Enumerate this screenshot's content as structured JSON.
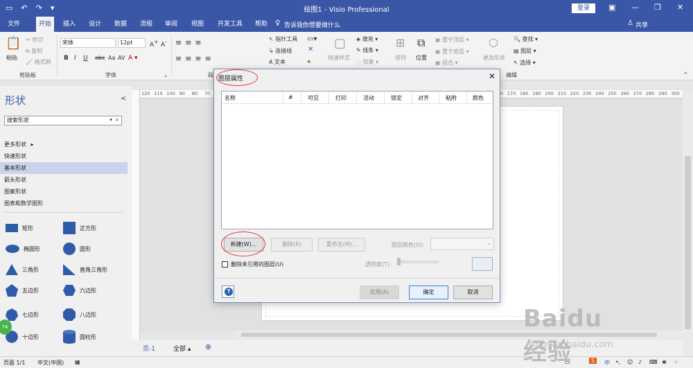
{
  "app": {
    "doc_title": "绘图1 - Visio Professional",
    "login_label": "登录",
    "accent": "#3a57a7"
  },
  "menu": {
    "tabs": [
      "文件",
      "开始",
      "插入",
      "设计",
      "数据",
      "流程",
      "审阅",
      "视图",
      "开发工具",
      "帮助"
    ],
    "active_tab": "开始",
    "tellme": "告诉我你想要做什么",
    "share": "共享"
  },
  "ribbon": {
    "paste": "粘贴",
    "cut": "剪切",
    "copy": "复制",
    "format_painter": "格式刷",
    "clipboard_group": "剪贴板",
    "font_name": "宋体",
    "font_size": "12pt",
    "font_group": "字体",
    "paragraph_group": "段",
    "pointer_tool": "指针工具",
    "connector": "连接线",
    "text": "文本",
    "quick_styles": "快速样式",
    "fill": "填充",
    "line": "线条",
    "effects": "效果",
    "arrange": "排列",
    "position": "位置",
    "bring_front": "置于顶层",
    "send_back": "置于底层",
    "group": "组合",
    "change_shape": "更改形状",
    "find": "查找",
    "layers": "图层",
    "select": "选择",
    "editing_group": "编辑"
  },
  "shapes_pane": {
    "title": "形状",
    "search_placeholder": "搜索形状",
    "stencils": [
      "更多形状",
      "快速形状",
      "基本形状",
      "箭头形状",
      "图案形状",
      "图表和数学图形"
    ],
    "active_stencil": "基本形状",
    "items": [
      {
        "label": "矩形",
        "icon": "rectangle-icon"
      },
      {
        "label": "正方形",
        "icon": "square-icon"
      },
      {
        "label": "椭圆形",
        "icon": "ellipse-icon"
      },
      {
        "label": "圆形",
        "icon": "circle-icon"
      },
      {
        "label": "三角形",
        "icon": "triangle-icon"
      },
      {
        "label": "直角三角形",
        "icon": "right-triangle-icon"
      },
      {
        "label": "五边形",
        "icon": "pentagon-icon"
      },
      {
        "label": "六边形",
        "icon": "hexagon-icon"
      },
      {
        "label": "七边形",
        "icon": "heptagon-icon"
      },
      {
        "label": "八边形",
        "icon": "octagon-icon"
      },
      {
        "label": "十边形",
        "icon": "decagon-icon"
      },
      {
        "label": "圆柱形",
        "icon": "cylinder-icon"
      }
    ],
    "badge": "74"
  },
  "ruler": {
    "labels": [
      "120",
      "110",
      "100",
      "90",
      "80",
      "70",
      "60",
      "50",
      "40",
      "30",
      "20",
      "10",
      "0",
      "10",
      "20",
      "30",
      "40",
      "50",
      "60",
      "70",
      "80",
      "90",
      "100",
      "110",
      "120",
      "130",
      "140",
      "150",
      "160",
      "170",
      "180",
      "190",
      "200",
      "210",
      "220",
      "230",
      "240",
      "250",
      "260",
      "270",
      "280",
      "290",
      "300",
      "310",
      "320",
      "330",
      "340",
      "350",
      "360",
      "370",
      "380"
    ]
  },
  "page_tabs": {
    "page1": "页-1",
    "all": "全部"
  },
  "status": {
    "page": "页面 1/1",
    "language": "中文(中国)",
    "ime": "中"
  },
  "dialog": {
    "title": "图层属性",
    "columns": [
      "名称",
      "#",
      "可见",
      "打印",
      "活动",
      "锁定",
      "对齐",
      "粘附",
      "颜色"
    ],
    "new_button": "新建(W)...",
    "delete_button": "删除(R)",
    "rename_button": "重命名(M)...",
    "layer_color_label": "图层颜色(O):",
    "remove_unreferenced": "删除未引用的图层(U)",
    "transparency_label": "透明度(T):",
    "apply_button": "应用(A)",
    "ok_button": "确定",
    "cancel_button": "取消"
  },
  "watermark": {
    "big": "Baidu经验",
    "small": "jingyan.baidu.com"
  }
}
